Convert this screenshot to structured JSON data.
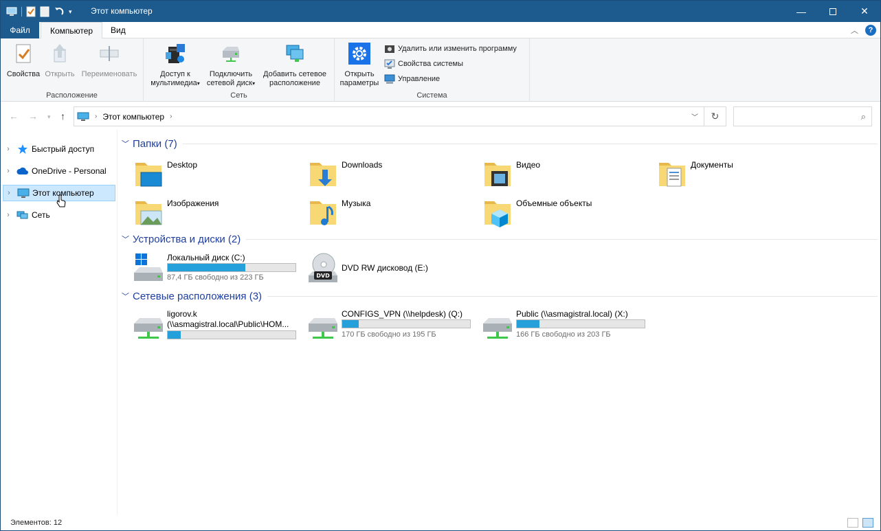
{
  "window": {
    "title": "Этот компьютер"
  },
  "tabs": {
    "file": "Файл",
    "computer": "Компьютер",
    "view": "Вид"
  },
  "ribbon": {
    "location": {
      "label": "Расположение",
      "properties": "Свойства",
      "open": "Открыть",
      "rename": "Переименовать"
    },
    "network": {
      "label": "Сеть",
      "media_line1": "Доступ к",
      "media_line2": "мультимедиа",
      "map_line1": "Подключить",
      "map_line2": "сетевой диск",
      "add_line1": "Добавить сетевое",
      "add_line2": "расположение"
    },
    "system": {
      "label": "Система",
      "settings_line1": "Открыть",
      "settings_line2": "параметры",
      "uninstall": "Удалить или изменить программу",
      "sysprops": "Свойства системы",
      "manage": "Управление"
    }
  },
  "address": {
    "path": "Этот компьютер",
    "search_placeholder": ""
  },
  "navpane": {
    "items": [
      {
        "label": "Быстрый доступ",
        "icon": "star-icon"
      },
      {
        "label": "OneDrive - Personal",
        "icon": "cloud-icon"
      },
      {
        "label": "Этот компьютер",
        "icon": "computer-icon",
        "selected": true
      },
      {
        "label": "Сеть",
        "icon": "network-icon"
      }
    ]
  },
  "sections": {
    "folders": "Папки (7)",
    "devices": "Устройства и диски (2)",
    "network": "Сетевые расположения (3)"
  },
  "folders": [
    {
      "name": "Desktop",
      "icon": "desktop-folder-icon"
    },
    {
      "name": "Downloads",
      "icon": "downloads-folder-icon"
    },
    {
      "name": "Видео",
      "icon": "video-folder-icon"
    },
    {
      "name": "Документы",
      "icon": "documents-folder-icon"
    },
    {
      "name": "Изображения",
      "icon": "pictures-folder-icon"
    },
    {
      "name": "Музыка",
      "icon": "music-folder-icon"
    },
    {
      "name": "Объемные объекты",
      "icon": "3d-objects-folder-icon"
    }
  ],
  "devices": [
    {
      "name": "Локальный диск (C:)",
      "free": "87,4 ГБ свободно из 223 ГБ",
      "used_fraction": 0.61
    },
    {
      "name": "DVD RW дисковод (E:)"
    }
  ],
  "network_locations": [
    {
      "name_line1": "ligorov.k",
      "name_line2": "(\\\\asmagistral.local\\Public\\HOM...",
      "used_fraction": 0.1
    },
    {
      "name": "CONFIGS_VPN (\\\\helpdesk) (Q:)",
      "free": "170 ГБ свободно из 195 ГБ",
      "used_fraction": 0.13
    },
    {
      "name": "Public (\\\\asmagistral.local) (X:)",
      "free": "166 ГБ свободно из 203 ГБ",
      "used_fraction": 0.18
    }
  ],
  "status": {
    "items": "Элементов: 12"
  },
  "colors": {
    "accent": "#1d5b8f",
    "section": "#1e3e9e",
    "bar": "#26a0da",
    "selection": "#cce8ff"
  }
}
